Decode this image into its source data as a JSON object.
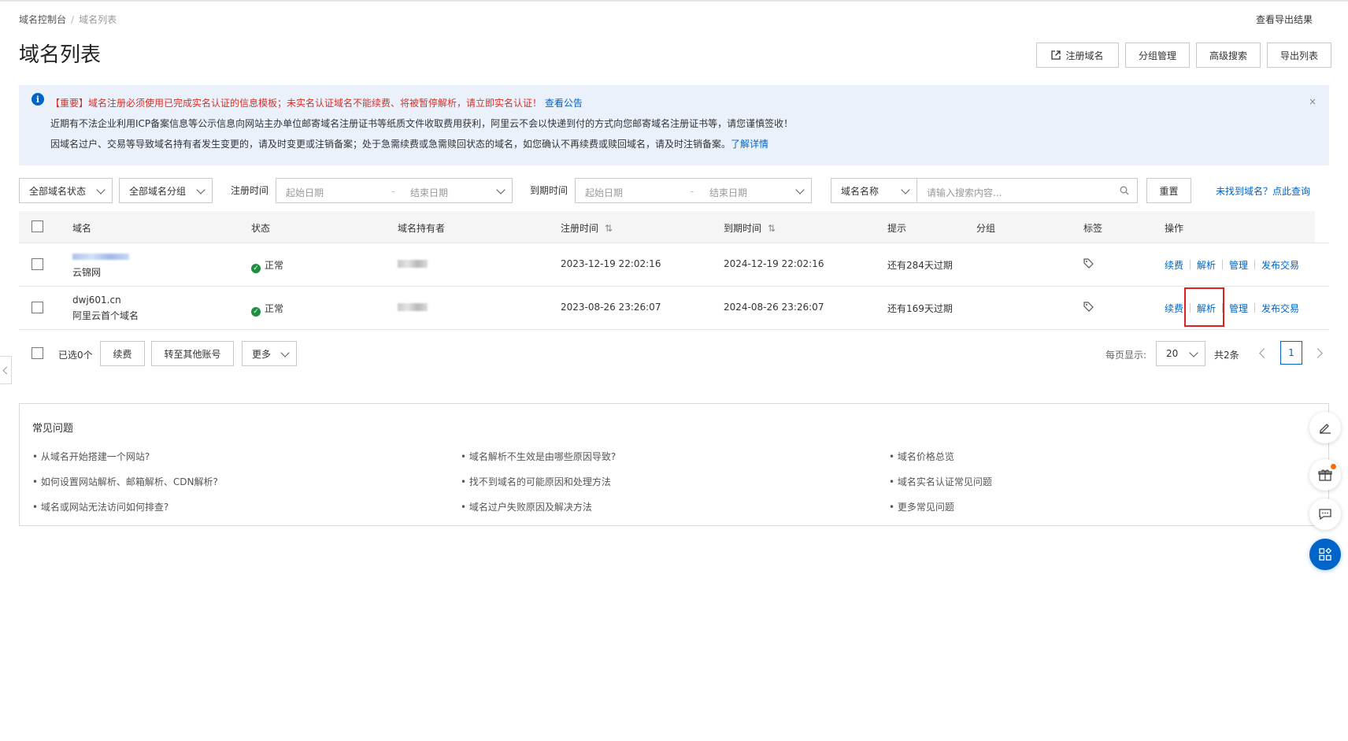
{
  "breadcrumb": {
    "root": "域名控制台",
    "current": "域名列表"
  },
  "header": {
    "export_result_link": "查看导出结果",
    "title": "域名列表",
    "buttons": {
      "register": "注册域名",
      "group_manage": "分组管理",
      "advanced_search": "高级搜索",
      "export_list": "导出列表"
    }
  },
  "notice": {
    "line1_important": "【重要】域名注册必须使用已完成实名认证的信息模板；未实名认证域名不能续费、将被暂停解析，请立即实名认证！",
    "line1_link": "查看公告",
    "line2": "近期有不法企业利用ICP备案信息等公示信息向网站主办单位邮寄域名注册证书等纸质文件收取费用获利，阿里云不会以快递到付的方式向您邮寄域名注册证书等，请您谨慎签收！",
    "line3": "因域名过户、交易等导致域名持有者发生变更的，请及时变更或注销备案；处于急需续费或急需赎回状态的域名，如您确认不再续费或赎回域名，请及时注销备案。",
    "line3_link": "了解详情",
    "close": "×"
  },
  "filters": {
    "status_select": "全部域名状态",
    "group_select": "全部域名分组",
    "reg_time_label": "注册时间",
    "exp_time_label": "到期时间",
    "start_placeholder": "起始日期",
    "end_placeholder": "结束日期",
    "range_sep": "-",
    "search_field_select": "域名名称",
    "search_placeholder": "请输入搜索内容...",
    "reset_button": "重置",
    "not_found_link": "未找到域名？点此查询"
  },
  "table": {
    "headers": {
      "domain": "域名",
      "status": "状态",
      "holder": "域名持有者",
      "reg_time": "注册时间",
      "exp_time": "到期时间",
      "tip": "提示",
      "group": "分组",
      "tag": "标签",
      "ops": "操作"
    },
    "sort_glyph": "⇅",
    "rows": [
      {
        "domain_sub": "云锦网",
        "status": "正常",
        "reg_time": "2023-12-19 22:02:16",
        "exp_time": "2024-12-19 22:02:16",
        "tip": "还有284天过期"
      },
      {
        "domain": "dwj601.cn",
        "domain_sub": "阿里云首个域名",
        "status": "正常",
        "reg_time": "2023-08-26 23:26:07",
        "exp_time": "2024-08-26 23:26:07",
        "tip": "还有169天过期"
      }
    ],
    "ops": {
      "renew": "续费",
      "resolve": "解析",
      "manage": "管理",
      "publish": "发布交易"
    }
  },
  "batch": {
    "selected": "已选0个",
    "renew": "续费",
    "transfer": "转至其他账号",
    "more": "更多"
  },
  "pagination": {
    "per_page_label": "每页显示:",
    "per_page_value": "20",
    "total": "共2条",
    "current_page": "1"
  },
  "faq": {
    "title": "常见问题",
    "items": [
      "• 从域名开始搭建一个网站?",
      "• 如何设置网站解析、邮箱解析、CDN解析?",
      "• 域名或网站无法访问如何排查?",
      "• 域名解析不生效是由哪些原因导致?",
      "• 找不到域名的可能原因和处理方法",
      "• 域名过户失败原因及解决方法",
      "• 域名价格总览",
      "• 域名实名认证常见问题",
      "• 更多常见问题"
    ]
  },
  "icons": {
    "info": "info-icon",
    "external": "external-link-icon",
    "status_ok": "check-circle-icon",
    "tag": "tag-icon",
    "search": "search-icon",
    "edit": "edit-icon",
    "gift": "gift-icon",
    "chat": "chat-icon",
    "apps": "apps-icon",
    "collapse": "chevron-left-icon"
  },
  "colors": {
    "link": "#0064c8",
    "important": "#d93026",
    "ok": "#1e8e3e",
    "highlight": "#e02020",
    "notice_bg": "#eaf1fb"
  }
}
